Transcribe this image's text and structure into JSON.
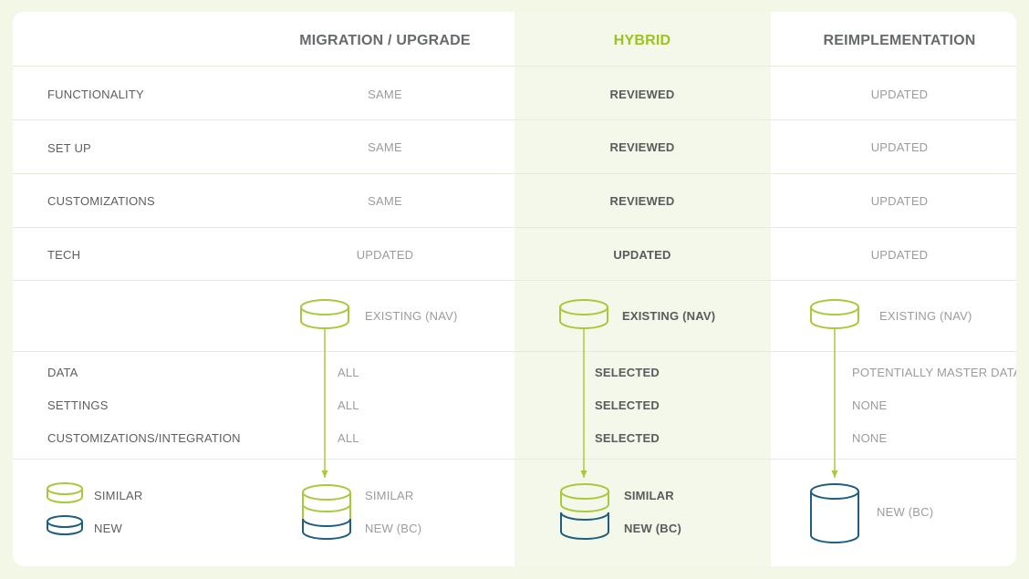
{
  "columns": {
    "migration": "MIGRATION / UPGRADE",
    "hybrid": "HYBRID",
    "reimplementation": "REIMPLEMENTATION"
  },
  "rows": [
    {
      "label": "FUNCTIONALITY",
      "migration": "SAME",
      "hybrid": "REVIEWED",
      "reimplementation": "UPDATED"
    },
    {
      "label": "SET UP",
      "migration": "SAME",
      "hybrid": "REVIEWED",
      "reimplementation": "UPDATED"
    },
    {
      "label": "CUSTOMIZATIONS",
      "migration": "SAME",
      "hybrid": "REVIEWED",
      "reimplementation": "UPDATED"
    },
    {
      "label": "TECH",
      "migration": "UPDATED",
      "hybrid": "UPDATED",
      "reimplementation": "UPDATED"
    }
  ],
  "source": {
    "migration": "EXISTING (NAV)",
    "hybrid": "EXISTING (NAV)",
    "reimplementation": "EXISTING (NAV)"
  },
  "transfer": [
    {
      "label": "DATA",
      "migration": "ALL",
      "hybrid": "SELECTED",
      "reimplementation": "POTENTIALLY MASTER DATA"
    },
    {
      "label": "SETTINGS",
      "migration": "ALL",
      "hybrid": "SELECTED",
      "reimplementation": "NONE"
    },
    {
      "label": "CUSTOMIZATIONS/INTEGRATION",
      "migration": "ALL",
      "hybrid": "SELECTED",
      "reimplementation": "NONE"
    }
  ],
  "legend": {
    "similar": "SIMILAR",
    "new": "NEW"
  },
  "result": {
    "migration": {
      "similar": "SIMILAR",
      "new": "NEW (BC)"
    },
    "hybrid": {
      "similar": "SIMILAR",
      "new": "NEW (BC)"
    },
    "reimplementation": {
      "new": "NEW (BC)"
    }
  },
  "colors": {
    "green": "#a9c93c",
    "blue": "#1f5e7e",
    "hybrid_band": "#f4f8ea"
  }
}
